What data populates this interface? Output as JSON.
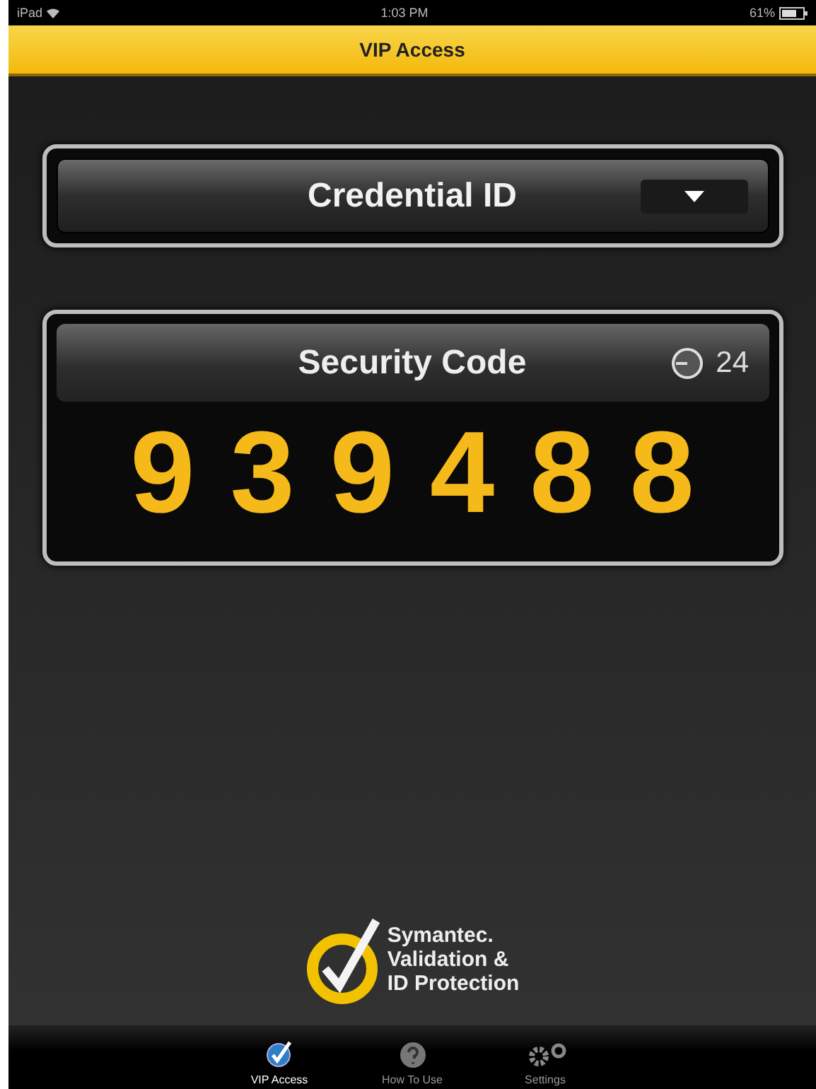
{
  "status_bar": {
    "carrier": "iPad",
    "time": "1:03 PM",
    "battery": "61%"
  },
  "nav_bar": {
    "title": "VIP Access"
  },
  "credential": {
    "label": "Credential ID"
  },
  "security_code": {
    "title": "Security Code",
    "seconds": "24",
    "code": "939488"
  },
  "logo": {
    "lines": [
      "Symantec.",
      "Validation &",
      "ID Protection"
    ]
  },
  "tabs": [
    {
      "label": "VIP Access",
      "kind": "check",
      "selected": true
    },
    {
      "label": "How To Use",
      "kind": "help",
      "selected": false
    },
    {
      "label": "Settings",
      "kind": "gears",
      "selected": false
    }
  ]
}
